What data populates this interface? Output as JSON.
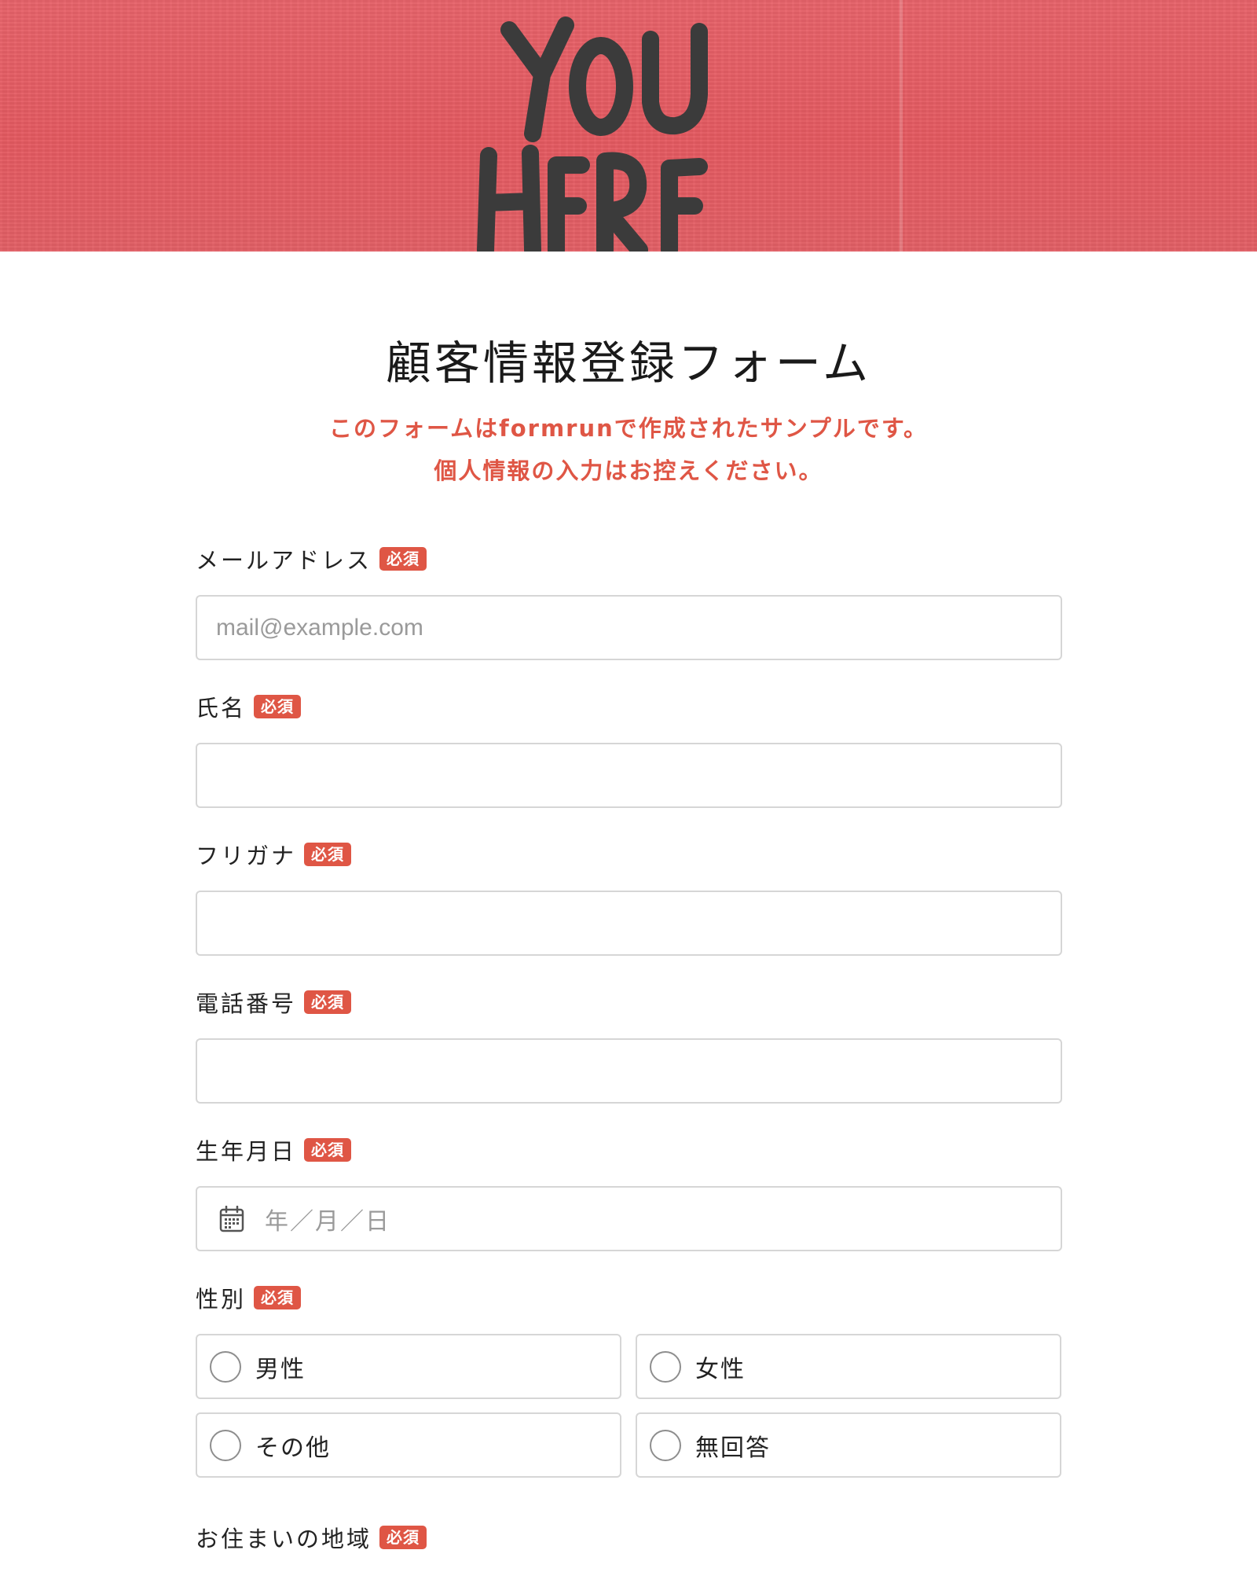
{
  "hero": {
    "painted_text_line1": "YOU",
    "painted_text_line2": "HERE"
  },
  "form": {
    "title": "顧客情報登録フォーム",
    "notice_line1": "このフォームはformrunで作成されたサンプルです。",
    "notice_line2": "個人情報の入力はお控えください。",
    "required_badge": "必須"
  },
  "fields": {
    "email": {
      "label": "メールアドレス",
      "placeholder": "mail@example.com",
      "value": ""
    },
    "name": {
      "label": "氏名",
      "placeholder": "",
      "value": ""
    },
    "furigana": {
      "label": "フリガナ",
      "placeholder": "",
      "value": ""
    },
    "phone": {
      "label": "電話番号",
      "placeholder": "",
      "value": ""
    },
    "birthday": {
      "label": "生年月日",
      "placeholder": "年／月／日"
    },
    "gender": {
      "label": "性別",
      "options": [
        "男性",
        "女性",
        "その他",
        "無回答"
      ]
    },
    "region": {
      "label": "お住まいの地域"
    }
  },
  "colors": {
    "accent": "#df5645",
    "hero_background": "#e55a61",
    "border": "#d6d6d6"
  },
  "icons": {
    "date": "calendar-icon",
    "radio": "radio-circle"
  }
}
